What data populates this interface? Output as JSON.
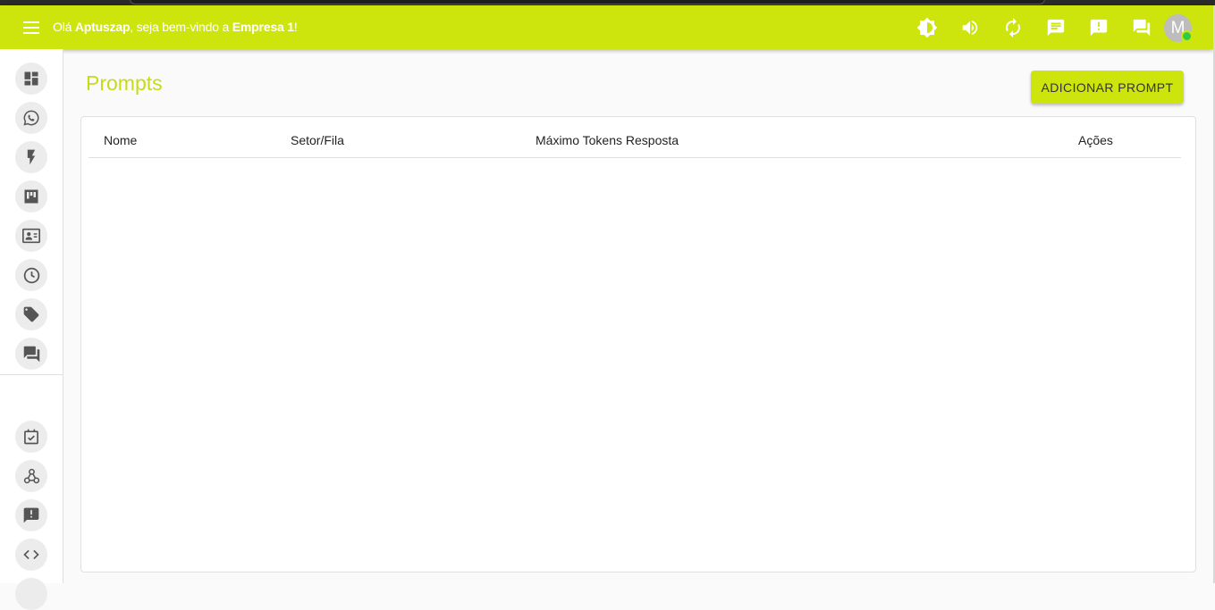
{
  "header": {
    "greeting_prefix": "Olá ",
    "user_name": "Aptuszap",
    "greeting_middle": ", seja bem-vindo a ",
    "company": "Empresa 1",
    "greeting_suffix": "!",
    "avatar_initial": "M",
    "icons": [
      "brightness-icon",
      "volume-icon",
      "refresh-icon",
      "chat-icon",
      "announcement-icon",
      "forum-icon"
    ]
  },
  "sidebar": {
    "items": [
      "dashboard-icon",
      "whatsapp-icon",
      "flash-icon",
      "kanban-icon",
      "contacts-icon",
      "clock-icon",
      "tag-icon",
      "forum-icon",
      "task-icon",
      "webhook-icon",
      "announcement-icon",
      "code-icon"
    ]
  },
  "main": {
    "title": "Prompts",
    "add_button": "ADICIONAR PROMPT",
    "columns": [
      "Nome",
      "Setor/Fila",
      "Máximo Tokens Resposta",
      "Ações"
    ]
  },
  "colors": {
    "accent": "#cde50d",
    "title": "#c7dc14",
    "icon": "#555555"
  }
}
